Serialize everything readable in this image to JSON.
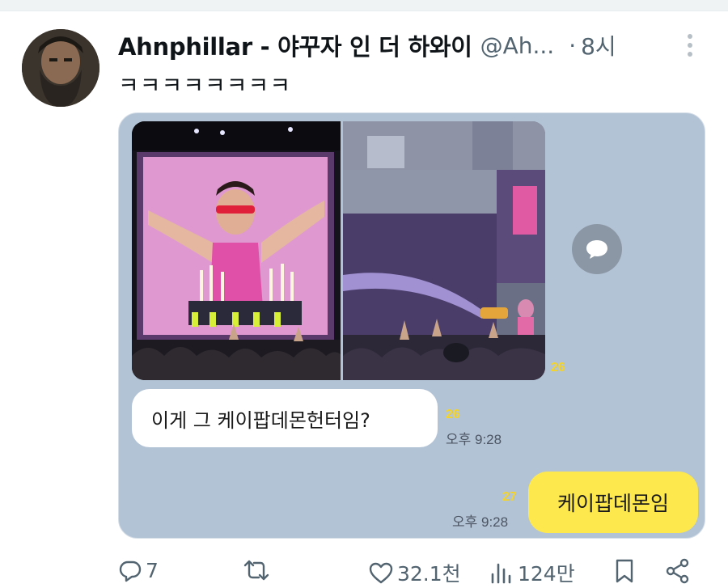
{
  "tweet": {
    "display_name": "Ahnphillar - 야꾸자 인 더 하와이",
    "handle": "@Ah...",
    "separator": "·",
    "time": "8시",
    "text": "ㅋㅋㅋㅋㅋㅋㅋㅋ"
  },
  "chat": {
    "photo_unread": "26",
    "received_message": "이게 그 케이팝데몬헌터임?",
    "received_unread": "26",
    "received_time": "오후 9:28",
    "sent_message": "케이팝데몬임",
    "sent_unread": "27",
    "sent_time": "오후 9:28"
  },
  "actions": {
    "reply_count": "7",
    "retweet_count": "",
    "like_count": "32.1천",
    "view_count": "124만"
  },
  "icons": {
    "more": "more-vertical-icon",
    "share_bubble": "chat-share-icon",
    "reply": "reply-icon",
    "retweet": "retweet-icon",
    "like": "heart-icon",
    "views": "views-icon",
    "bookmark": "bookmark-icon",
    "share": "share-icon"
  },
  "colors": {
    "chat_background": "#b3c3d6",
    "sent_bubble": "#fde84d",
    "unread_badge": "#f5d427",
    "muted_text": "#536471"
  }
}
